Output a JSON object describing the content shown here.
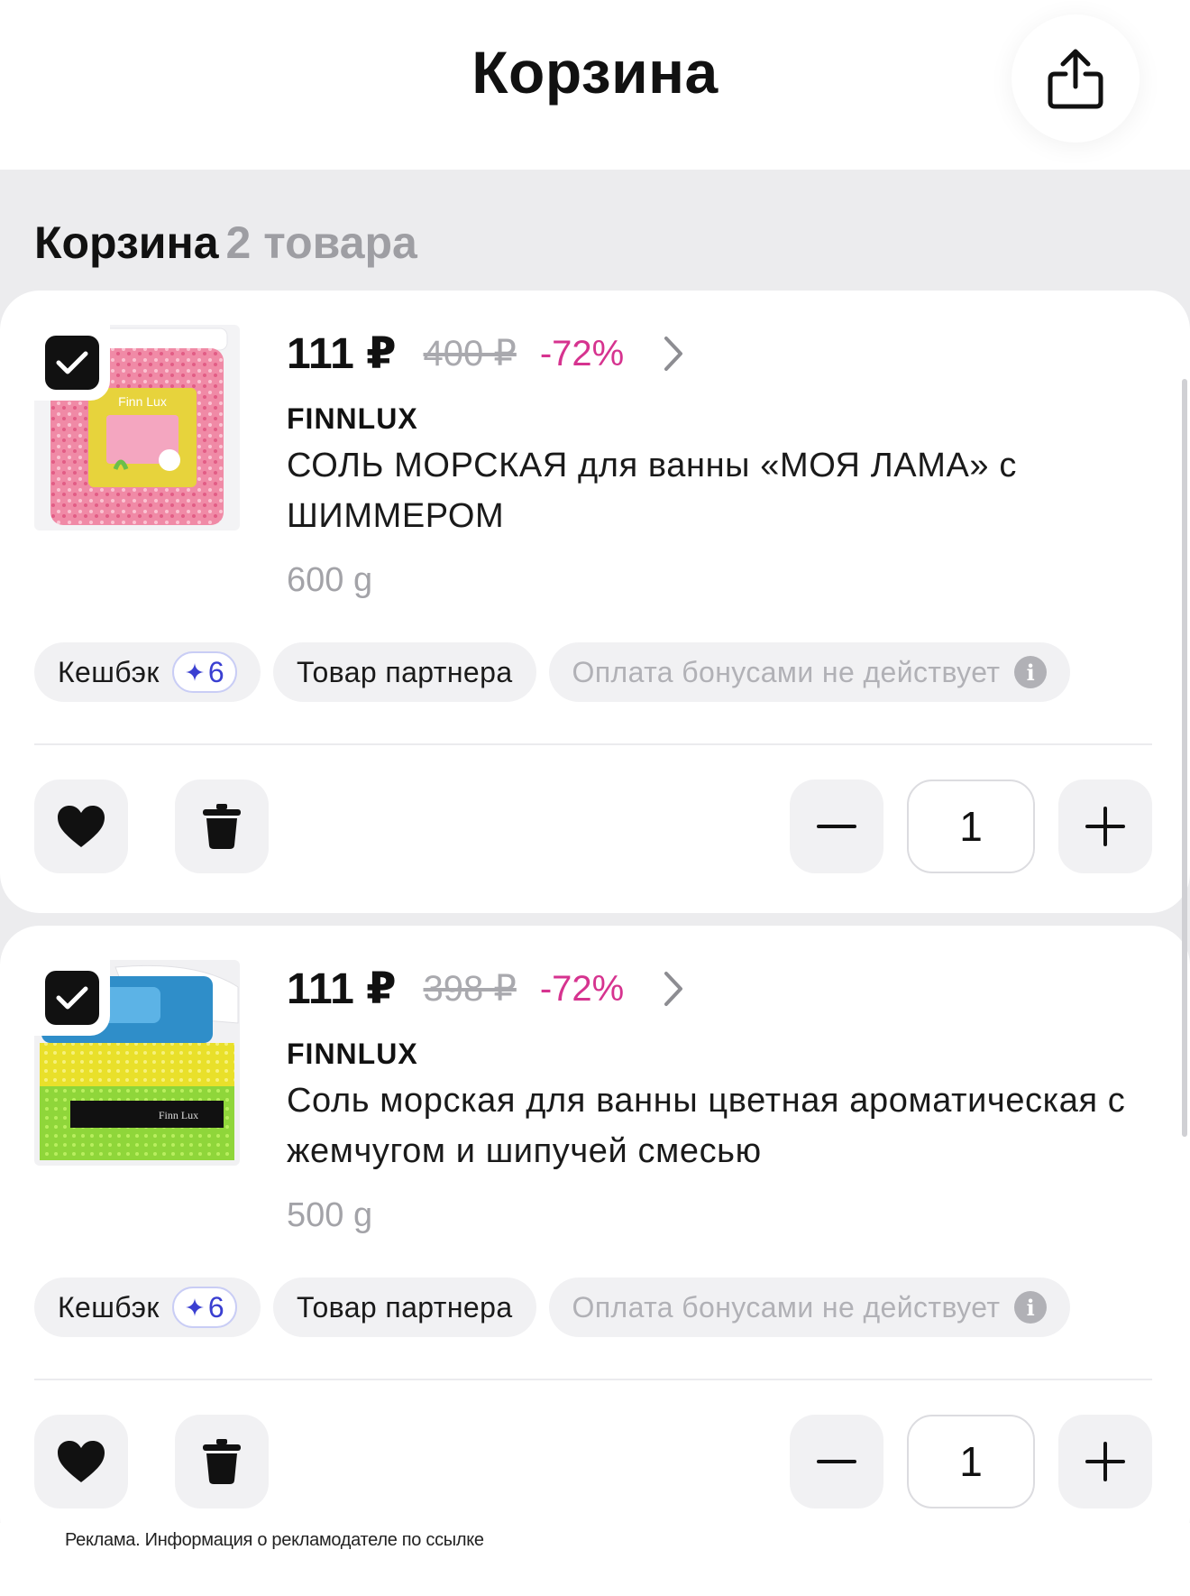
{
  "header": {
    "title": "Корзина",
    "share_icon": "share-icon"
  },
  "section": {
    "title": "Корзина",
    "count": "2 товара"
  },
  "items": [
    {
      "checked": true,
      "price": "111 ₽",
      "old_price": "400 ₽",
      "discount": "-72%",
      "brand": "FINNLUX",
      "name": "СОЛЬ МОРСКАЯ для ванны «МОЯ ЛАМА» с ШИММЕРОМ",
      "weight": "600 g",
      "chips": {
        "cashback_label": "Кешбэк",
        "cashback_value": "6",
        "partner": "Товар партнера",
        "bonus_note": "Оплата бонусами не действует"
      },
      "quantity": "1"
    },
    {
      "checked": true,
      "price": "111 ₽",
      "old_price": "398 ₽",
      "discount": "-72%",
      "brand": "FINNLUX",
      "name": "Соль морская для ванны цветная ароматическая с жемчугом и шипучей смесью",
      "weight": "500 g",
      "chips": {
        "cashback_label": "Кешбэк",
        "cashback_value": "6",
        "partner": "Товар партнера",
        "bonus_note": "Оплата бонусами не действует"
      },
      "quantity": "1"
    }
  ],
  "footer": {
    "ad_text": "Реклама. Информация о рекламодателе по ссылке"
  },
  "colors": {
    "discount": "#d6338f",
    "bonus": "#3a3fd1",
    "background_gray": "#ececee"
  }
}
